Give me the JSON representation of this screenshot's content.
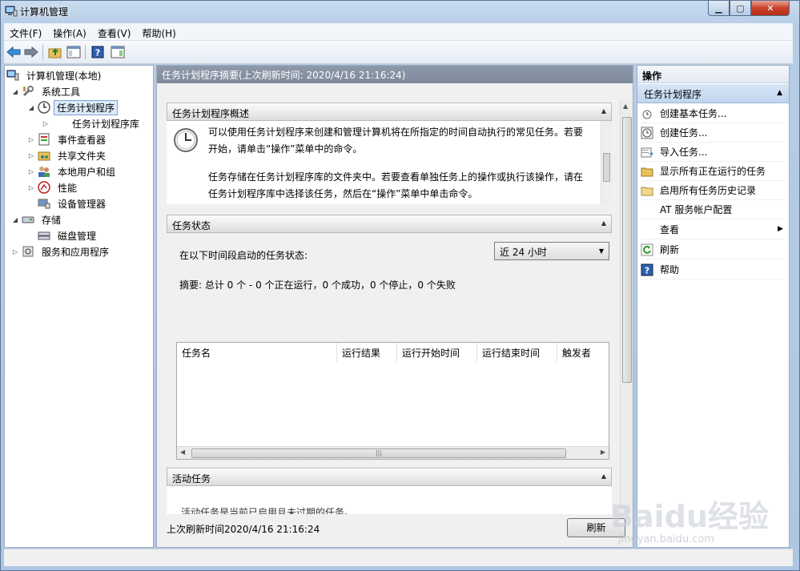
{
  "window": {
    "title": "计算机管理"
  },
  "menu": [
    "文件(F)",
    "操作(A)",
    "查看(V)",
    "帮助(H)"
  ],
  "tree": {
    "root": "计算机管理(本地)",
    "system_tools": "系统工具",
    "task_scheduler": "任务计划程序",
    "task_library": "任务计划程序库",
    "event_viewer": "事件查看器",
    "shared_folders": "共享文件夹",
    "local_users": "本地用户和组",
    "performance": "性能",
    "device_manager": "设备管理器",
    "storage": "存储",
    "disk_management": "磁盘管理",
    "services_apps": "服务和应用程序"
  },
  "center": {
    "header": "任务计划程序摘要(上次刷新时间: 2020/4/16 21:16:24)",
    "overview": {
      "title": "任务计划程序概述",
      "para1_line1": "可以使用任务计划程序来创建和管理计算机将在所指定的时间自动执行的常见任务。若要",
      "para1_line2": "开始，请单击“操作”菜单中的命令。",
      "para2_line1": "任务存储在任务计划程序库的文件夹中。若要查看单独任务上的操作或执行该操作，请在",
      "para2_line2": "任务计划程序库中选择该任务，然后在“操作”菜单中单击命令。"
    },
    "status": {
      "title": "任务状态",
      "period_label": "在以下时间段启动的任务状态:",
      "period_value": "近 24 小时",
      "summary": "摘要: 总计 0 个 - 0 个正在运行，0 个成功，0 个停止，0 个失败",
      "columns": [
        "任务名",
        "运行结果",
        "运行开始时间",
        "运行结束时间",
        "触发者"
      ]
    },
    "active": {
      "title": "活动任务",
      "partial_text": "活动任务是当前已启用且未过期的任务。"
    },
    "footer": {
      "last_refresh": "上次刷新时间2020/4/16 21:16:24",
      "refresh_button": "刷新"
    }
  },
  "actions": {
    "title": "操作",
    "group": "任务计划程序",
    "items": [
      "创建基本任务...",
      "创建任务...",
      "导入任务...",
      "显示所有正在运行的任务",
      "启用所有任务历史记录",
      "AT 服务帐户配置",
      "查看",
      "刷新",
      "帮助"
    ]
  },
  "watermark": {
    "text": "Baidu经验",
    "url": "jingyan.baidu.com"
  }
}
